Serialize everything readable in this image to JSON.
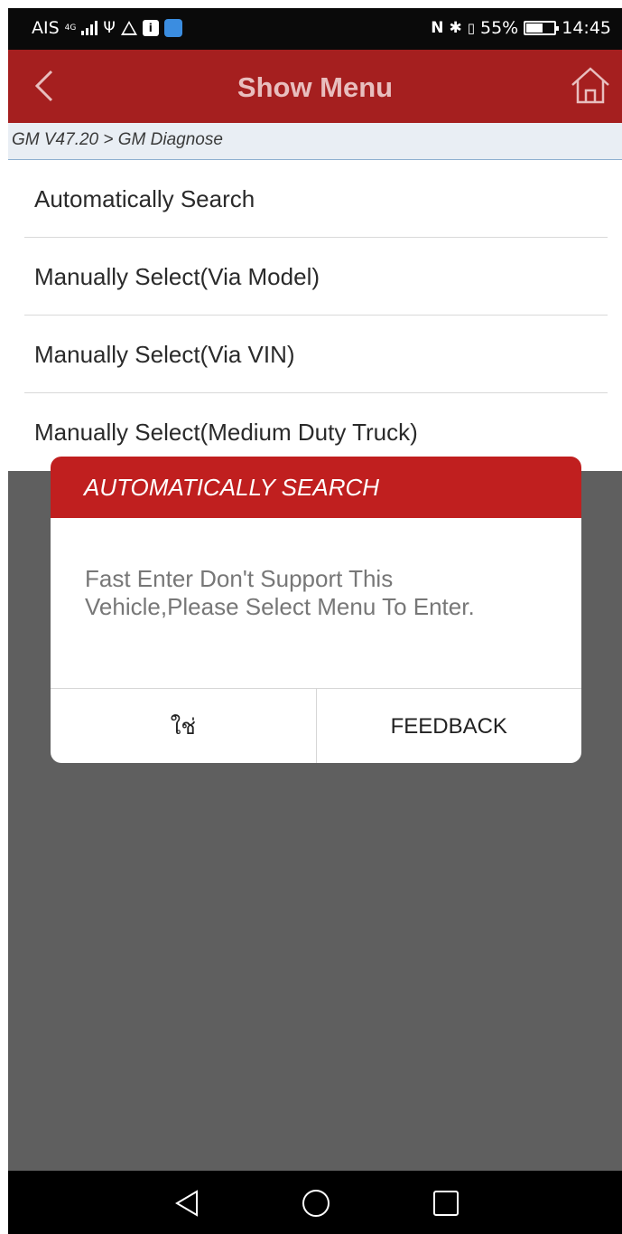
{
  "status_bar": {
    "carrier": "AIS",
    "network": "4G",
    "battery": "55%",
    "time": "14:45",
    "icons": [
      "signal-icon",
      "hotspot-icon",
      "warning-icon",
      "info-icon",
      "app-icon",
      "nfc-icon",
      "bluetooth-icon",
      "vibrate-icon",
      "battery-icon"
    ]
  },
  "header": {
    "title": "Show Menu",
    "back_icon": "chevron-left-icon",
    "home_icon": "home-icon"
  },
  "breadcrumb": {
    "text": "GM V47.20 > GM Diagnose"
  },
  "menu": {
    "items": [
      {
        "label": "Automatically Search"
      },
      {
        "label": "Manually Select(Via Model)"
      },
      {
        "label": "Manually Select(Via VIN)"
      },
      {
        "label": "Manually Select(Medium Duty Truck)"
      }
    ]
  },
  "dialog": {
    "title": "AUTOMATICALLY SEARCH",
    "message": "Fast Enter Don't Support This Vehicle,Please Select Menu To Enter.",
    "confirm_label": "ใช่",
    "feedback_label": "FEEDBACK"
  },
  "nav": {
    "icons": [
      "back-triangle-icon",
      "home-circle-icon",
      "recents-square-icon"
    ]
  },
  "colors": {
    "header_bg": "#a51f1f",
    "dialog_header_bg": "#c01f1f",
    "overlay": "#5f5f5f",
    "breadcrumb_bg": "#e9eef4"
  }
}
